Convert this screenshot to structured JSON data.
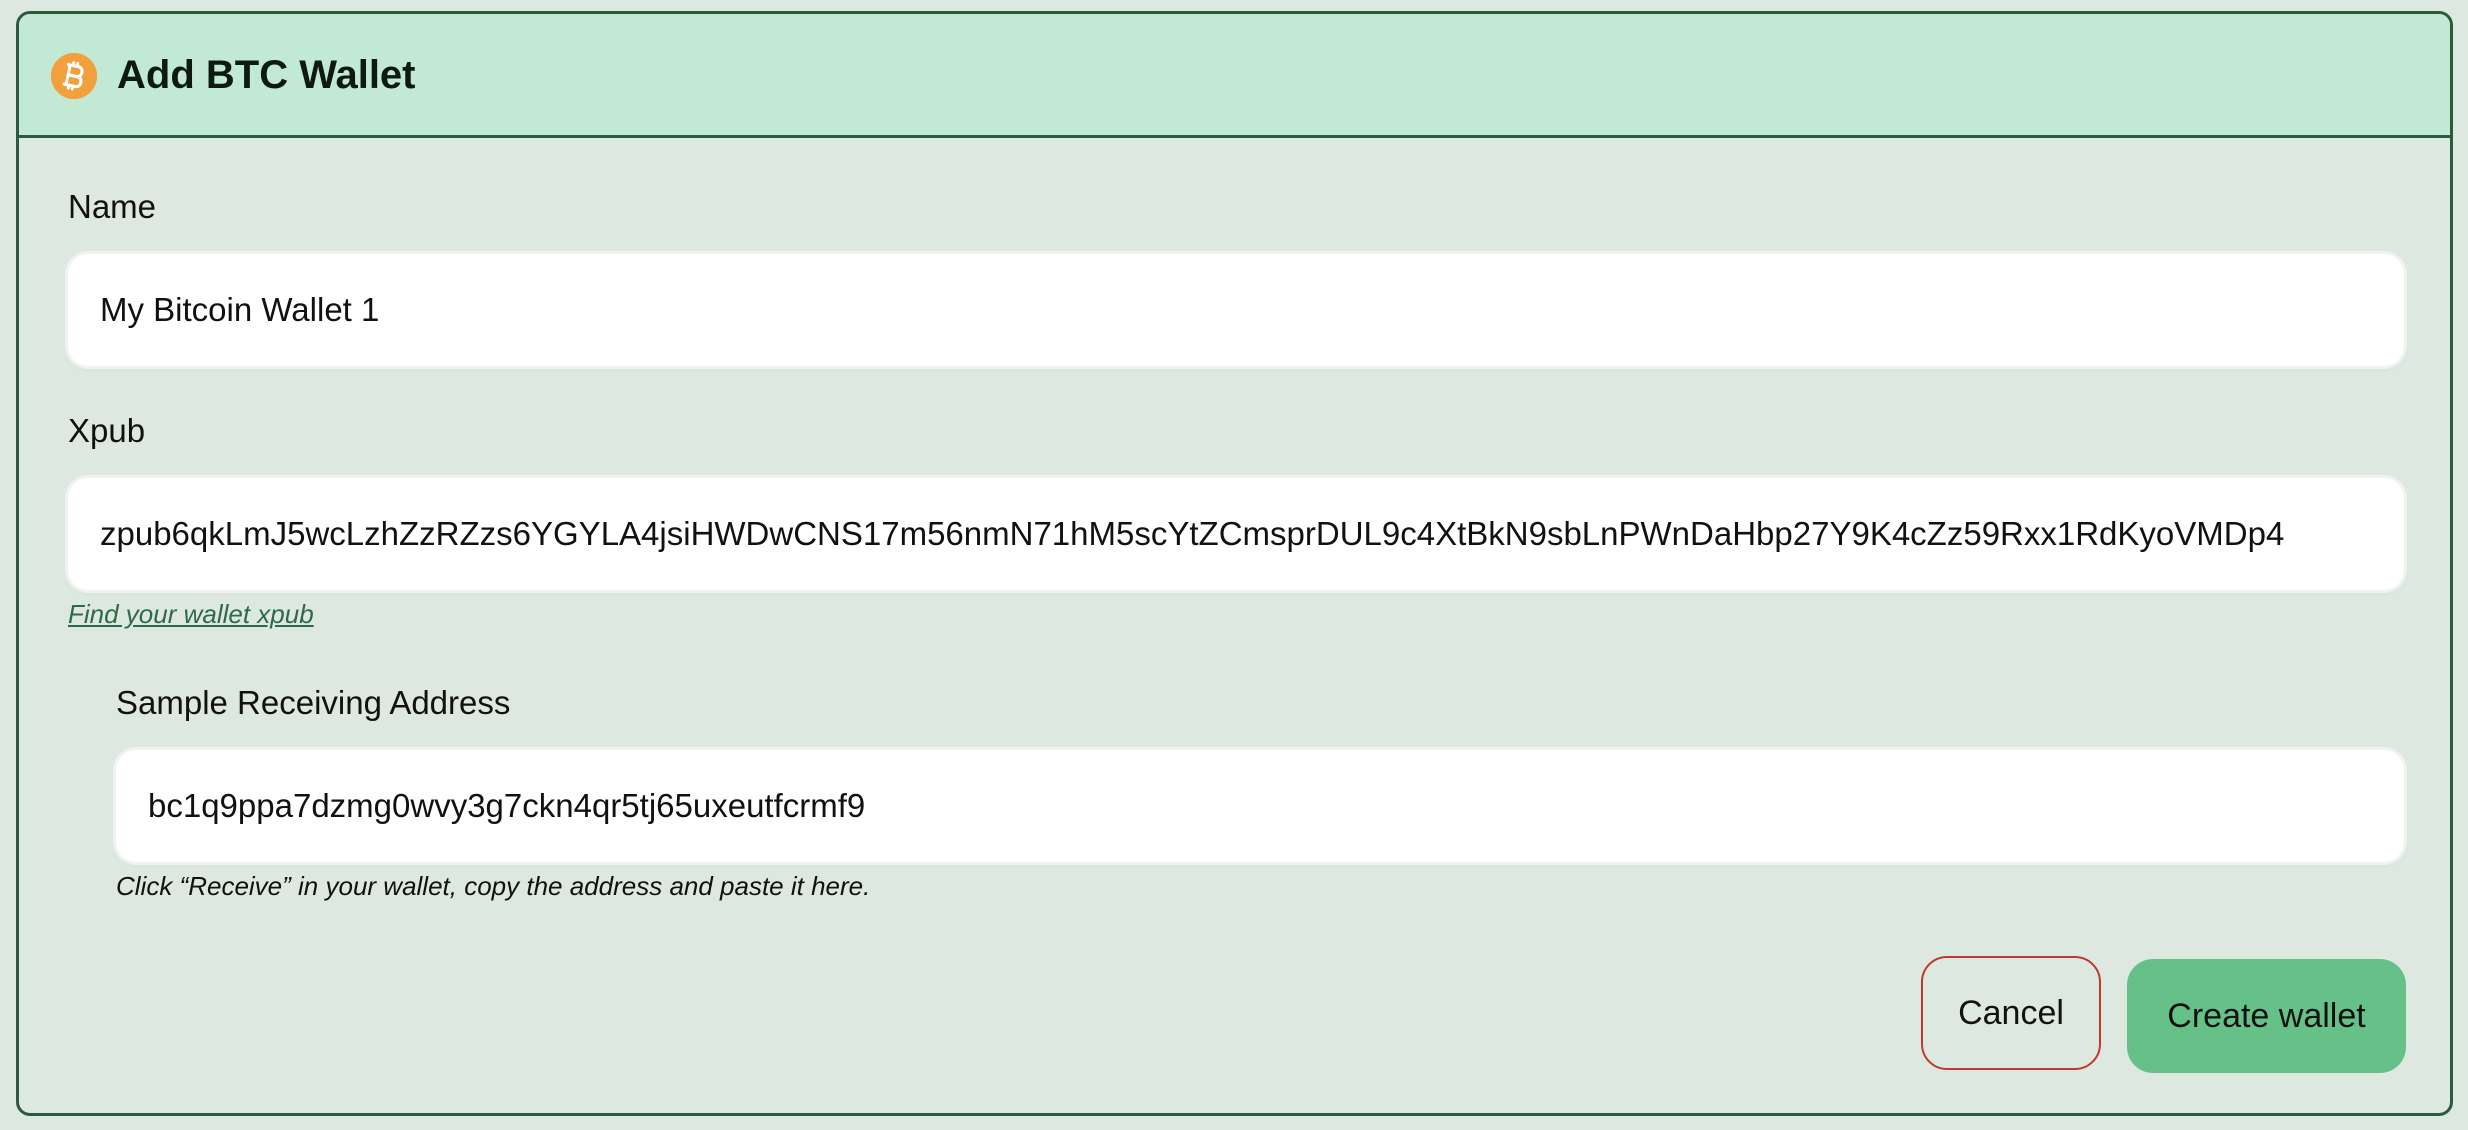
{
  "dialog": {
    "title": "Add BTC Wallet",
    "icon": "bitcoin-icon"
  },
  "name_field": {
    "label": "Name",
    "value": "My Bitcoin Wallet 1"
  },
  "xpub_field": {
    "label": "Xpub",
    "value": "zpub6qkLmJ5wcLzhZzRZzs6YGYLA4jsiHWDwCNS17m56nmN71hM5scYtZCmsprDUL9c4XtBkN9sbLnPWnDaHbp27Y9K4cZz59Rxx1RdKyoVMDp4",
    "help_link": "Find your wallet xpub"
  },
  "address_field": {
    "label": "Sample Receiving Address",
    "value": "bc1q9ppa7dzmg0wvy3g7ckn4qr5tj65uxeutfcrmf9",
    "hint": "Click “Receive” in your wallet, copy the address and paste it here."
  },
  "actions": {
    "cancel_label": "Cancel",
    "create_label": "Create wallet"
  },
  "colors": {
    "header_bg": "#c1e9d3",
    "body_bg": "#dde9e0",
    "border": "#2c5a40",
    "bitcoin_orange": "#f2a03d",
    "primary_button": "#66c189",
    "cancel_border": "#c0392b",
    "link": "#2f6a48"
  }
}
